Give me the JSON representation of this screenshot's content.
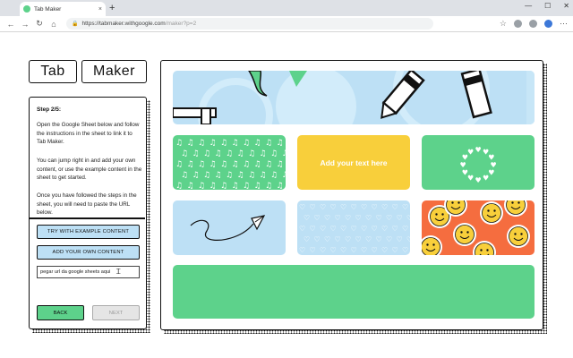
{
  "browser": {
    "tab_title": "Tab Maker",
    "tab_close": "×",
    "new_tab": "+",
    "url_host": "https://tabmaker.withgoogle.com",
    "url_path": "/maker?p=2",
    "window_controls": [
      "—",
      "☐",
      "✕"
    ],
    "icons": [
      "back-icon",
      "forward-icon",
      "reload-icon",
      "home-icon",
      "lock-icon",
      "star-icon",
      "extension-icon",
      "profile-icon",
      "menu-icon"
    ]
  },
  "logo": {
    "part1": "Tab",
    "part2": "Maker"
  },
  "steps": {
    "heading": "Step 2/5:",
    "para1": "Open the Google Sheet below and follow the instructions in the sheet to link it to Tab Maker.",
    "para2": "You can jump right in and add your own content, or use the example content in the sheet to get started.",
    "para3": "Once you have followed the steps in the sheet, you will need to paste the URL below.",
    "try_example": "TRY WITH EXAMPLE CONTENT",
    "add_own": "ADD YOUR OWN CONTENT",
    "url_value": "pegar url da google sheets aqui",
    "back": "BACK",
    "next": "NEXT"
  },
  "preview": {
    "yellow_tile_text": "Add your text here",
    "colors": {
      "green": "#5dd28b",
      "blue": "#bde0f5",
      "yellow": "#f8cf3b",
      "orange": "#f56d3f"
    }
  }
}
